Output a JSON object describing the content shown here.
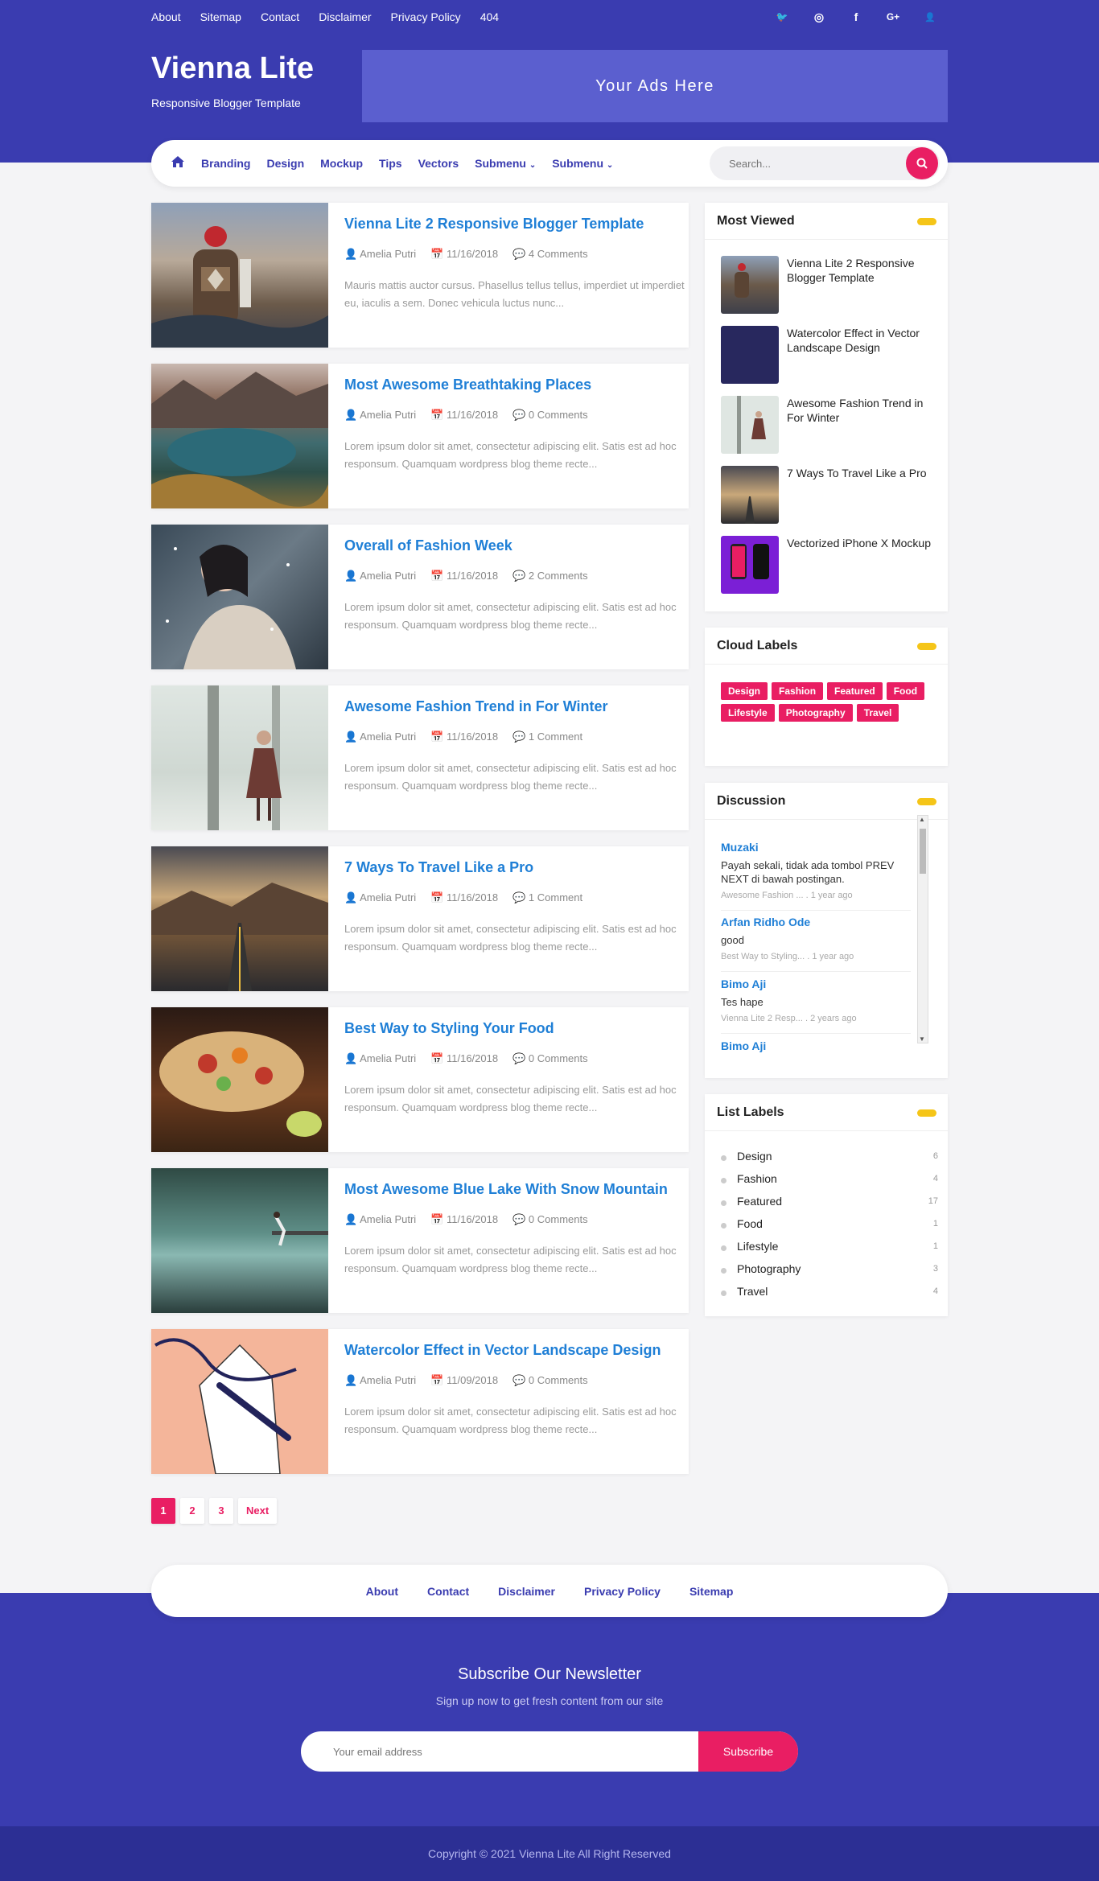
{
  "topnav": {
    "links": [
      "About",
      "Sitemap",
      "Contact",
      "Disclaimer",
      "Privacy Policy",
      "404"
    ],
    "social_icons": [
      "twitter-icon",
      "instagram-icon",
      "facebook-icon",
      "google-plus-icon",
      "user-icon"
    ],
    "social_glyphs": [
      "🐦",
      "◎",
      "f",
      "G+",
      "👤"
    ]
  },
  "header": {
    "title": "Vienna Lite",
    "description": "Responsive Blogger Template",
    "ad_text": "Your Ads Here"
  },
  "mainnav": {
    "items": [
      "Branding",
      "Design",
      "Mockup",
      "Tips",
      "Vectors",
      "Submenu",
      "Submenu"
    ],
    "search_placeholder": "Search..."
  },
  "posts": [
    {
      "title": "Vienna Lite 2 Responsive Blogger Template",
      "author": "Amelia Putri",
      "date": "11/16/2018",
      "comments": "4 Comments",
      "excerpt": "Mauris mattis auctor cursus. Phasellus tellus tellus, imperdiet ut imperdiet eu, iaculis a sem. Donec vehicula luctus nunc..."
    },
    {
      "title": "Most Awesome Breathtaking Places",
      "author": "Amelia Putri",
      "date": "11/16/2018",
      "comments": "0 Comments",
      "excerpt": "Lorem ipsum dolor sit amet, consectetur adipiscing elit. Satis est ad hoc responsum. Quamquam wordpress blog theme recte..."
    },
    {
      "title": "Overall of Fashion Week",
      "author": "Amelia Putri",
      "date": "11/16/2018",
      "comments": "2 Comments",
      "excerpt": "Lorem ipsum dolor sit amet, consectetur adipiscing elit. Satis est ad hoc responsum. Quamquam wordpress blog theme recte..."
    },
    {
      "title": "Awesome Fashion Trend in For Winter",
      "author": "Amelia Putri",
      "date": "11/16/2018",
      "comments": "1 Comment",
      "excerpt": "Lorem ipsum dolor sit amet, consectetur adipiscing elit. Satis est ad hoc responsum. Quamquam wordpress blog theme recte..."
    },
    {
      "title": "7 Ways To Travel Like a Pro",
      "author": "Amelia Putri",
      "date": "11/16/2018",
      "comments": "1 Comment",
      "excerpt": "Lorem ipsum dolor sit amet, consectetur adipiscing elit. Satis est ad hoc responsum. Quamquam wordpress blog theme recte..."
    },
    {
      "title": "Best Way to Styling Your Food",
      "author": "Amelia Putri",
      "date": "11/16/2018",
      "comments": "0 Comments",
      "excerpt": "Lorem ipsum dolor sit amet, consectetur adipiscing elit. Satis est ad hoc responsum. Quamquam wordpress blog theme recte..."
    },
    {
      "title": "Most Awesome Blue Lake With Snow Mountain",
      "author": "Amelia Putri",
      "date": "11/16/2018",
      "comments": "0 Comments",
      "excerpt": "Lorem ipsum dolor sit amet, consectetur adipiscing elit. Satis est ad hoc responsum. Quamquam wordpress blog theme recte..."
    },
    {
      "title": "Watercolor Effect in Vector Landscape Design",
      "author": "Amelia Putri",
      "date": "11/09/2018",
      "comments": "0 Comments",
      "excerpt": "Lorem ipsum dolor sit amet, consectetur adipiscing elit. Satis est ad hoc responsum. Quamquam wordpress blog theme recte..."
    }
  ],
  "pagination": [
    "1",
    "2",
    "3",
    "Next"
  ],
  "sidebar": {
    "most_viewed": {
      "title": "Most Viewed",
      "items": [
        "Vienna Lite 2 Responsive Blogger Template",
        "Watercolor Effect in Vector Landscape Design",
        "Awesome Fashion Trend in For Winter",
        "7 Ways To Travel Like a Pro",
        "Vectorized iPhone X Mockup"
      ]
    },
    "cloud_labels": {
      "title": "Cloud Labels",
      "tags": [
        "Design",
        "Fashion",
        "Featured",
        "Food",
        "Lifestyle",
        "Photography",
        "Travel"
      ]
    },
    "discussion": {
      "title": "Discussion",
      "comments": [
        {
          "author": "Muzaki",
          "text": "Payah sekali, tidak ada tombol PREV NEXT di bawah postingan.",
          "post": "Awesome Fashion ...",
          "time": ". 1 year ago"
        },
        {
          "author": "Arfan Ridho Ode",
          "text": "good",
          "post": "Best Way to Styling...",
          "time": ". 1 year ago"
        },
        {
          "author": "Bimo Aji",
          "text": "Tes hape",
          "post": "Vienna Lite 2 Resp...",
          "time": ". 2 years ago"
        },
        {
          "author": "Bimo Aji",
          "text": "",
          "post": "",
          "time": ""
        }
      ]
    },
    "list_labels": {
      "title": "List Labels",
      "items": [
        {
          "name": "Design",
          "count": "6"
        },
        {
          "name": "Fashion",
          "count": "4"
        },
        {
          "name": "Featured",
          "count": "17"
        },
        {
          "name": "Food",
          "count": "1"
        },
        {
          "name": "Lifestyle",
          "count": "1"
        },
        {
          "name": "Photography",
          "count": "3"
        },
        {
          "name": "Travel",
          "count": "4"
        }
      ]
    }
  },
  "footer": {
    "links": [
      "About",
      "Contact",
      "Disclaimer",
      "Privacy Policy",
      "Sitemap"
    ],
    "newsletter_title": "Subscribe Our Newsletter",
    "newsletter_subtitle": "Sign up now to get fresh content from our site",
    "email_placeholder": "Your email address",
    "subscribe_label": "Subscribe",
    "copyright": "Copyright © 2021 Vienna Lite All Right Reserved"
  },
  "colors": {
    "primary": "#3a3cb0",
    "accent": "#e91e63",
    "link": "#1f7fd6",
    "pill": "#f5c518"
  }
}
